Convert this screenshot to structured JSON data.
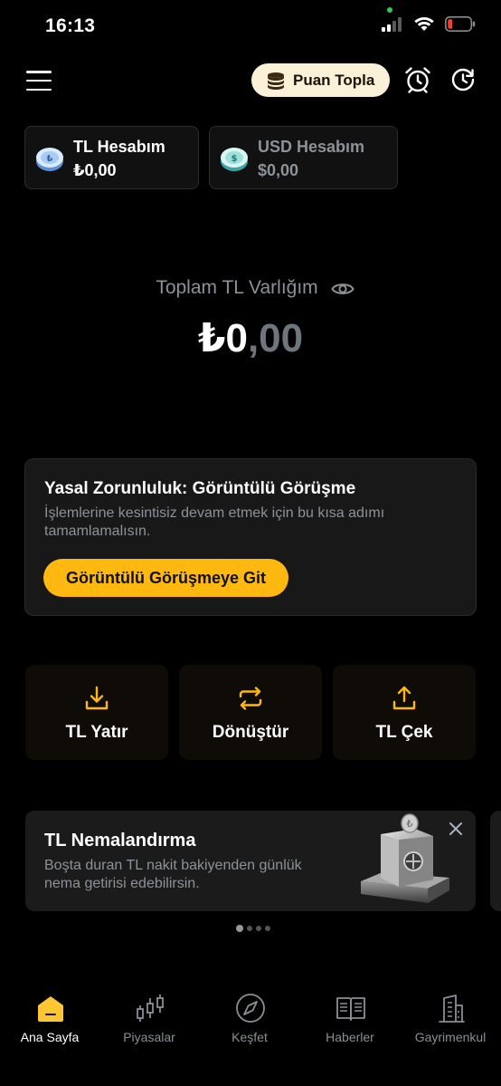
{
  "status_bar": {
    "time": "16:13"
  },
  "header": {
    "puan_label": "Puan Topla"
  },
  "accounts": [
    {
      "name": "TL Hesabım",
      "balance": "₺0,00"
    },
    {
      "name": "USD Hesabım",
      "balance": "$0,00"
    }
  ],
  "total": {
    "label": "Toplam TL Varlığım",
    "value_int": "₺0",
    "value_dec": ",00"
  },
  "legal": {
    "title": "Yasal Zorunluluk: Görüntülü Görüşme",
    "description": "İşlemlerine kesintisiz devam etmek için bu kısa adımı tamamlamalısın.",
    "button": "Görüntülü Görüşmeye Git"
  },
  "actions": [
    {
      "label": "TL Yatır",
      "icon": "download-icon"
    },
    {
      "label": "Dönüştür",
      "icon": "swap-icon"
    },
    {
      "label": "TL Çek",
      "icon": "upload-icon"
    }
  ],
  "banner": {
    "title": "TL Nemalandırma",
    "description": "Boşta duran TL nakit bakiyenden günlük nema getirisi edebilirsin."
  },
  "carousel": {
    "total": 4,
    "active": 0
  },
  "bottom_nav": [
    {
      "label": "Ana Sayfa",
      "icon": "home-icon",
      "active": true
    },
    {
      "label": "Piyasalar",
      "icon": "candlestick-icon",
      "active": false
    },
    {
      "label": "Keşfet",
      "icon": "compass-icon",
      "active": false
    },
    {
      "label": "Haberler",
      "icon": "newspaper-icon",
      "active": false
    },
    {
      "label": "Gayrimenkul",
      "icon": "building-icon",
      "active": false
    }
  ],
  "colors": {
    "accent": "#ffb810",
    "background": "#000000",
    "card": "#181818",
    "muted_text": "#8c9298"
  }
}
